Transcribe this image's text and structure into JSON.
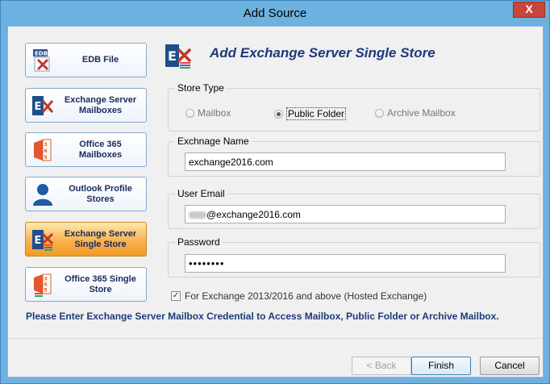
{
  "window": {
    "title": "Add Source",
    "close_label": "X"
  },
  "sidebar": {
    "items": [
      {
        "label": "EDB File",
        "icon": "edb-file-icon",
        "active": false
      },
      {
        "label": "Exchange Server Mailboxes",
        "icon": "exchange-mailboxes-icon",
        "active": false
      },
      {
        "label": "Office 365 Mailboxes",
        "icon": "office365-mailboxes-icon",
        "active": false
      },
      {
        "label": "Outlook Profile Stores",
        "icon": "outlook-profile-icon",
        "active": false
      },
      {
        "label": "Exchange Server Single Store",
        "icon": "exchange-single-store-icon",
        "active": true
      },
      {
        "label": "Office 365 Single Store",
        "icon": "office365-single-store-icon",
        "active": false
      }
    ]
  },
  "main": {
    "heading": "Add Exchange Server Single Store",
    "store_type": {
      "label": "Store Type",
      "options": [
        "Mailbox",
        "Public Folder",
        "Archive Mailbox"
      ],
      "selected": "Public Folder"
    },
    "exchange_name": {
      "label": "Exchnage Name",
      "value": "exchange2016.com"
    },
    "user_email": {
      "label": "User Email",
      "value": "@exchange2016.com"
    },
    "password": {
      "label": "Password",
      "value": "••••••••"
    },
    "hosted_checkbox": {
      "label": "For Exchange 2013/2016 and above (Hosted Exchange)",
      "checked": true
    },
    "info_text": "Please Enter Exchange Server Mailbox Credential to Access Mailbox, Public Folder or Archive Mailbox."
  },
  "footer": {
    "back_label": "< Back",
    "finish_label": "Finish",
    "cancel_label": "Cancel"
  },
  "colors": {
    "active_item": "#f8b24e",
    "heading": "#1f3a7a",
    "titlebar": "#6cb1e0",
    "close": "#c7463c"
  }
}
